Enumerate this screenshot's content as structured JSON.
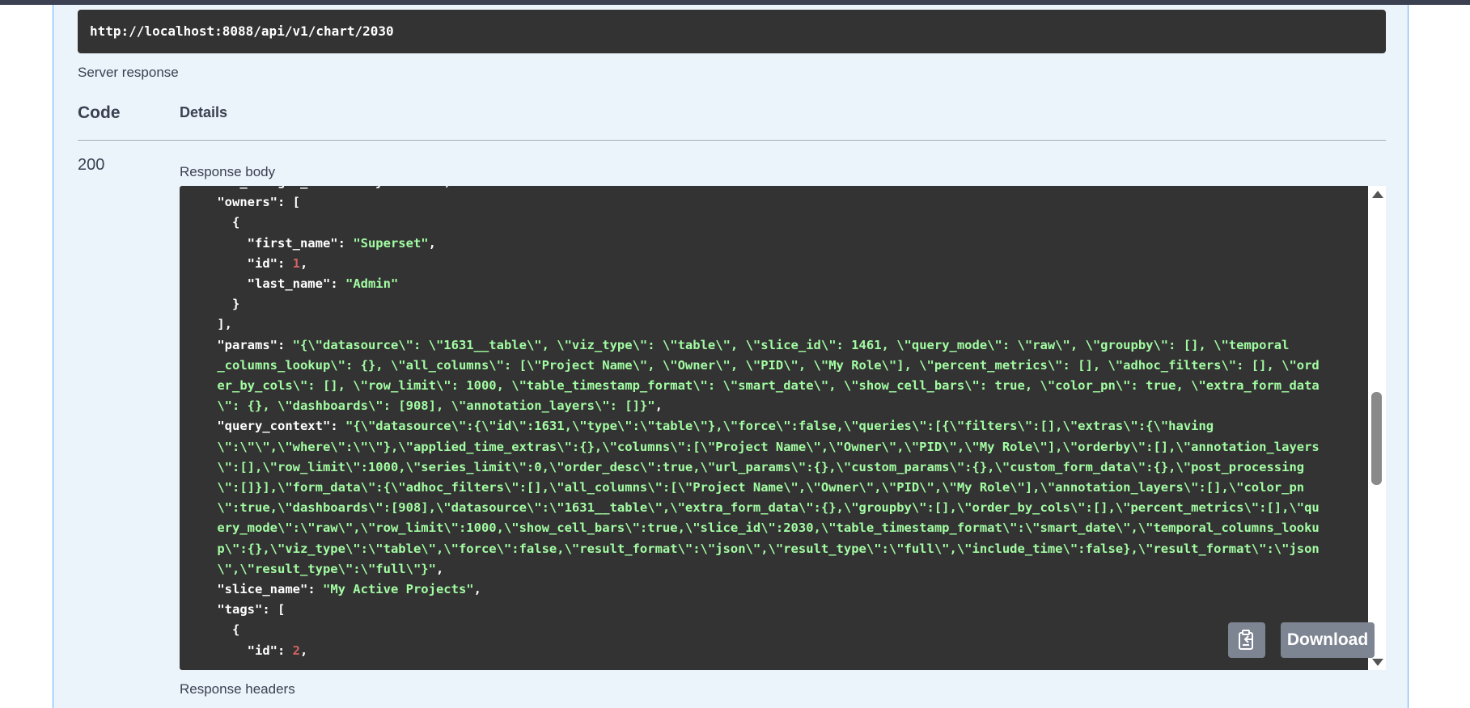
{
  "request_url": "http://localhost:8088/api/v1/chart/2030",
  "server_response_label": "Server response",
  "table_header": {
    "code": "Code",
    "details": "Details"
  },
  "response": {
    "code": "200",
    "body_label": "Response body",
    "headers_label": "Response headers",
    "download_label": "Download",
    "copy_icon": "clipboard-icon",
    "body_lines": [
      [
        [
          "k",
          "    \"is_managed_externally\""
        ],
        [
          "p",
          ": "
        ],
        [
          "b",
          "false"
        ],
        [
          "p",
          ","
        ]
      ],
      [
        [
          "k",
          "    \"owners\""
        ],
        [
          "p",
          ": ["
        ]
      ],
      [
        [
          "p",
          "      {"
        ]
      ],
      [
        [
          "k",
          "        \"first_name\""
        ],
        [
          "p",
          ": "
        ],
        [
          "s",
          "\"Superset\""
        ],
        [
          "p",
          ","
        ]
      ],
      [
        [
          "k",
          "        \"id\""
        ],
        [
          "p",
          ": "
        ],
        [
          "n",
          "1"
        ],
        [
          "p",
          ","
        ]
      ],
      [
        [
          "k",
          "        \"last_name\""
        ],
        [
          "p",
          ": "
        ],
        [
          "s",
          "\"Admin\""
        ]
      ],
      [
        [
          "p",
          "      }"
        ]
      ],
      [
        [
          "p",
          "    ],"
        ]
      ],
      [
        [
          "k",
          "    \"params\""
        ],
        [
          "p",
          ": "
        ],
        [
          "s",
          "\"{\\\"datasource\\\": \\\"1631__table\\\", \\\"viz_type\\\": \\\"table\\\", \\\"slice_id\\\": 1461, \\\"query_mode\\\": \\\"raw\\\", \\\"groupby\\\": [], \\\"temporal"
        ]
      ],
      [
        [
          "s",
          "    _columns_lookup\\\": {}, \\\"all_columns\\\": [\\\"Project Name\\\", \\\"Owner\\\", \\\"PID\\\", \\\"My Role\\\"], \\\"percent_metrics\\\": [], \\\"adhoc_filters\\\": [], \\\"ord"
        ]
      ],
      [
        [
          "s",
          "    er_by_cols\\\": [], \\\"row_limit\\\": 1000, \\\"table_timestamp_format\\\": \\\"smart_date\\\", \\\"show_cell_bars\\\": true, \\\"color_pn\\\": true, \\\"extra_form_data"
        ]
      ],
      [
        [
          "s",
          "    \\\": {}, \\\"dashboards\\\": [908], \\\"annotation_layers\\\": []}\""
        ],
        [
          "p",
          ","
        ]
      ],
      [
        [
          "k",
          "    \"query_context\""
        ],
        [
          "p",
          ": "
        ],
        [
          "s",
          "\"{\\\"datasource\\\":{\\\"id\\\":1631,\\\"type\\\":\\\"table\\\"},\\\"force\\\":false,\\\"queries\\\":[{\\\"filters\\\":[],\\\"extras\\\":{\\\"having"
        ]
      ],
      [
        [
          "s",
          "    \\\":\\\"\\\",\\\"where\\\":\\\"\\\"},\\\"applied_time_extras\\\":{},\\\"columns\\\":[\\\"Project Name\\\",\\\"Owner\\\",\\\"PID\\\",\\\"My Role\\\"],\\\"orderby\\\":[],\\\"annotation_layers"
        ]
      ],
      [
        [
          "s",
          "    \\\":[],\\\"row_limit\\\":1000,\\\"series_limit\\\":0,\\\"order_desc\\\":true,\\\"url_params\\\":{},\\\"custom_params\\\":{},\\\"custom_form_data\\\":{},\\\"post_processing"
        ]
      ],
      [
        [
          "s",
          "    \\\":[]}],\\\"form_data\\\":{\\\"adhoc_filters\\\":[],\\\"all_columns\\\":[\\\"Project Name\\\",\\\"Owner\\\",\\\"PID\\\",\\\"My Role\\\"],\\\"annotation_layers\\\":[],\\\"color_pn"
        ]
      ],
      [
        [
          "s",
          "    \\\":true,\\\"dashboards\\\":[908],\\\"datasource\\\":\\\"1631__table\\\",\\\"extra_form_data\\\":{},\\\"groupby\\\":[],\\\"order_by_cols\\\":[],\\\"percent_metrics\\\":[],\\\"qu"
        ]
      ],
      [
        [
          "s",
          "    ery_mode\\\":\\\"raw\\\",\\\"row_limit\\\":1000,\\\"show_cell_bars\\\":true,\\\"slice_id\\\":2030,\\\"table_timestamp_format\\\":\\\"smart_date\\\",\\\"temporal_columns_looku"
        ]
      ],
      [
        [
          "s",
          "    p\\\":{},\\\"viz_type\\\":\\\"table\\\",\\\"force\\\":false,\\\"result_format\\\":\\\"json\\\",\\\"result_type\\\":\\\"full\\\",\\\"include_time\\\":false},\\\"result_format\\\":\\\"json"
        ]
      ],
      [
        [
          "s",
          "    \\\",\\\"result_type\\\":\\\"full\\\"}\""
        ],
        [
          "p",
          ","
        ]
      ],
      [
        [
          "k",
          "    \"slice_name\""
        ],
        [
          "p",
          ": "
        ],
        [
          "s",
          "\"My Active Projects\""
        ],
        [
          "p",
          ","
        ]
      ],
      [
        [
          "k",
          "    \"tags\""
        ],
        [
          "p",
          ": ["
        ]
      ],
      [
        [
          "p",
          "      {"
        ]
      ],
      [
        [
          "k",
          "        \"id\""
        ],
        [
          "p",
          ": "
        ],
        [
          "n",
          "2"
        ],
        [
          "p",
          ","
        ]
      ]
    ]
  }
}
